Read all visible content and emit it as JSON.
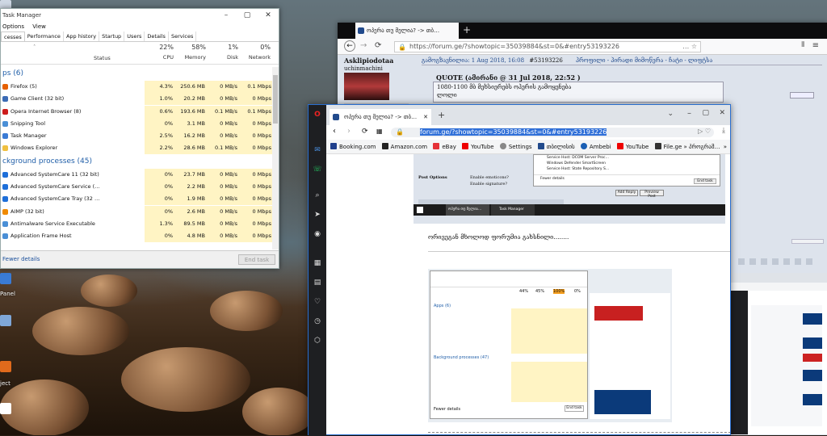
{
  "task_manager": {
    "title": "Task Manager",
    "menu": [
      "Options",
      "View"
    ],
    "tabs": [
      "cesses",
      "Performance",
      "App history",
      "Startup",
      "Users",
      "Details",
      "Services"
    ],
    "headers": {
      "cpu_pct": "22%",
      "mem_pct": "58%",
      "disk_pct": "1%",
      "net_pct": "0%",
      "status": "Status",
      "cpu": "CPU",
      "memory": "Memory",
      "disk": "Disk",
      "network": "Network"
    },
    "apps_header": "ps (6)",
    "apps": [
      {
        "name": "Firefox (5)",
        "cpu": "4.3%",
        "mem": "250.6 MB",
        "disk": "0 MB/s",
        "net": "0.1 Mbps"
      },
      {
        "name": "Game Client (32 bit)",
        "cpu": "1.0%",
        "mem": "20.2 MB",
        "disk": "0 MB/s",
        "net": "0 Mbps"
      },
      {
        "name": "Opera Internet Browser (8)",
        "cpu": "0.6%",
        "mem": "193.6 MB",
        "disk": "0.1 MB/s",
        "net": "0.1 Mbps"
      },
      {
        "name": "Snipping Tool",
        "cpu": "0%",
        "mem": "3.1 MB",
        "disk": "0 MB/s",
        "net": "0 Mbps"
      },
      {
        "name": "Task Manager",
        "cpu": "2.5%",
        "mem": "16.2 MB",
        "disk": "0 MB/s",
        "net": "0 Mbps"
      },
      {
        "name": "Windows Explorer",
        "cpu": "2.2%",
        "mem": "28.6 MB",
        "disk": "0.1 MB/s",
        "net": "0 Mbps"
      }
    ],
    "bg_header": "ckground processes (45)",
    "bg": [
      {
        "name": "Advanced SystemCare 11 (32 bit)",
        "cpu": "0%",
        "mem": "23.7 MB",
        "disk": "0 MB/s",
        "net": "0 Mbps"
      },
      {
        "name": "Advanced SystemCare Service (…",
        "cpu": "0%",
        "mem": "2.2 MB",
        "disk": "0 MB/s",
        "net": "0 Mbps"
      },
      {
        "name": "Advanced SystemCare Tray (32 …",
        "cpu": "0%",
        "mem": "1.9 MB",
        "disk": "0 MB/s",
        "net": "0 Mbps"
      },
      {
        "name": "AIMP (32 bit)",
        "cpu": "0%",
        "mem": "2.6 MB",
        "disk": "0 MB/s",
        "net": "0 Mbps"
      },
      {
        "name": "Antimalware Service Executable",
        "cpu": "1.3%",
        "mem": "89.5 MB",
        "disk": "0 MB/s",
        "net": "0 Mbps"
      },
      {
        "name": "Application Frame Host",
        "cpu": "0%",
        "mem": "4.8 MB",
        "disk": "0 MB/s",
        "net": "0 Mbps"
      }
    ],
    "fewer_details": "Fewer details",
    "end_task": "End task"
  },
  "desktop": {
    "labels": [
      "Panel",
      "ject"
    ]
  },
  "firefox": {
    "tab_title": "ოპერა თუ მელია? -> თბ…",
    "url": "https://forum.ge/?showtopic=35039884&st=0&#entry53193226",
    "post": {
      "author": "Asklipiodotaa",
      "author_sub": "uchinmachini",
      "date": "გამოგზავნილია: 1 Aug 2018, 16:08",
      "entry": "#53193226",
      "links": "პროფილი - პირადი მიმოწერა - ჩატი - ლიფტსა",
      "quote_header": "QUOTE (ამირანი @ 31 Jul 2018, 22:52 )",
      "quote_text": "1080-1100 მბ მეხსიერებს ოპერის გამოყენება",
      "quote_line2": "ლოლი",
      "reply_text": "ორივეგან მხოლოდ ფორუმია გახსნილი........"
    }
  },
  "opera": {
    "tab_title": "ოპერა თუ მელია? -> თბ…",
    "url": "forum.ge/?showtopic=35039884&st=0&#entry53193226",
    "bookmarks": [
      "Booking.com",
      "Amazon.com",
      "eBay",
      "YouTube",
      "Settings",
      "თბილისის",
      "Ambebi",
      "YouTube",
      "File.ge » პროგრამ…"
    ],
    "embedded": {
      "post_options": "Post Options",
      "enable_emoticons": "Enable emoticons?",
      "enable_signature": "Enable signature?",
      "add_reply": "Add Reply",
      "preview_post": "Preview Post",
      "mini_rows": [
        "Service Host: DCOM Server Proc…",
        "Windows Defender SmartScreen",
        "Service Host: State Repository S…"
      ],
      "fewer": "Fewer details",
      "end": "End task",
      "taskbar_item1": "ოპერა თუ მელია…",
      "taskbar_item2": "Task Manager",
      "ss_tm": {
        "cpu": "44%",
        "mem": "45%",
        "disk": "100%",
        "net": "0%",
        "apps": "Apps (6)",
        "bg": "Background processes (47)",
        "fewer": "Fewer details",
        "end": "End task"
      }
    }
  }
}
